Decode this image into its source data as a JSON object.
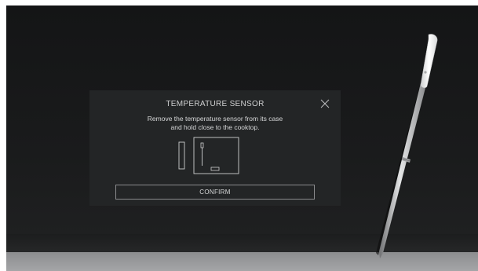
{
  "dialog": {
    "title": "TEMPERATURE SENSOR",
    "message_line1": "Remove the temperature sensor from its case",
    "message_line2": "and hold close to the cooktop.",
    "confirm_label": "CONFIRM",
    "close_icon": "close-icon",
    "illustration_icon": "sensor-case-illustration-icon"
  },
  "colors": {
    "cooktop": "#161718",
    "dialog_bg": "#232526",
    "text": "#d6d7d8",
    "button_border": "#8a8b8d",
    "counter": "#9a9b9d",
    "probe_handle": "#f2f2f2"
  }
}
